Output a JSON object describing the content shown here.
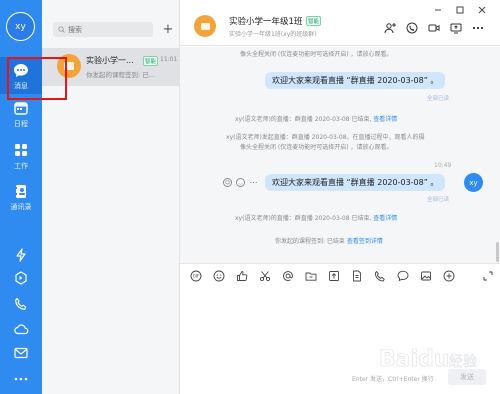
{
  "nav": {
    "user_initials": "xy",
    "items": [
      {
        "name": "messages",
        "label": "消息"
      },
      {
        "name": "schedule",
        "label": "日程"
      },
      {
        "name": "work",
        "label": "工作"
      },
      {
        "name": "contacts",
        "label": "通讯录"
      }
    ]
  },
  "search": {
    "placeholder": "搜索"
  },
  "conversation": {
    "title": "实验小学一...",
    "tag": "智能",
    "time": "11:01",
    "preview": "你发起的课程签到: 已..."
  },
  "header": {
    "title": "实验小学一年级1班",
    "tag": "智能",
    "subtitle": "实验小学一年级1班(xy的班级群)"
  },
  "messages": {
    "sys_top": "像头全程关闭 (仅连麦功能时可选择开启) ，请放心观看。",
    "bubble1": "欢迎大家来观看直播 “群直播 2020-03-08” 。",
    "read1": "全部已读",
    "sys_end1_text": "xy(语文老师)的直播：群直播 2020-03-08 已结束,",
    "sys_end1_link": "查看详情",
    "sys_start_line1": "xy(语文老师)发起直播：群直播 2020-03-08，在直播过程中，观看人的摄",
    "sys_start_line2": "像头全程关闭 (仅连麦功能时可选择开启) ，请放心观看。",
    "time": "10:49",
    "bubble2": "欢迎大家来观看直播 “群直播 2020-03-08” 。",
    "read2": "全部已读",
    "me_initials": "xy",
    "sys_end2_text": "xy(语文老师)的直播：群直播 2020-03-08 已结束,",
    "sys_end2_link": "查看详情",
    "sys_checkin_text": "你发起的课程签到: 已结束",
    "sys_checkin_link": "查看签到详情"
  },
  "composer": {
    "send_hint": "Enter 发送，Ctrl+Enter 换行",
    "send_label": "发送"
  },
  "watermark": {
    "text": "Baidu 经验"
  },
  "colors": {
    "nav_blue": "#2f8bf0",
    "bubble": "#cfe6fd",
    "highlight_box": "#e8141c",
    "avatar_orange": "#f2a33a"
  }
}
